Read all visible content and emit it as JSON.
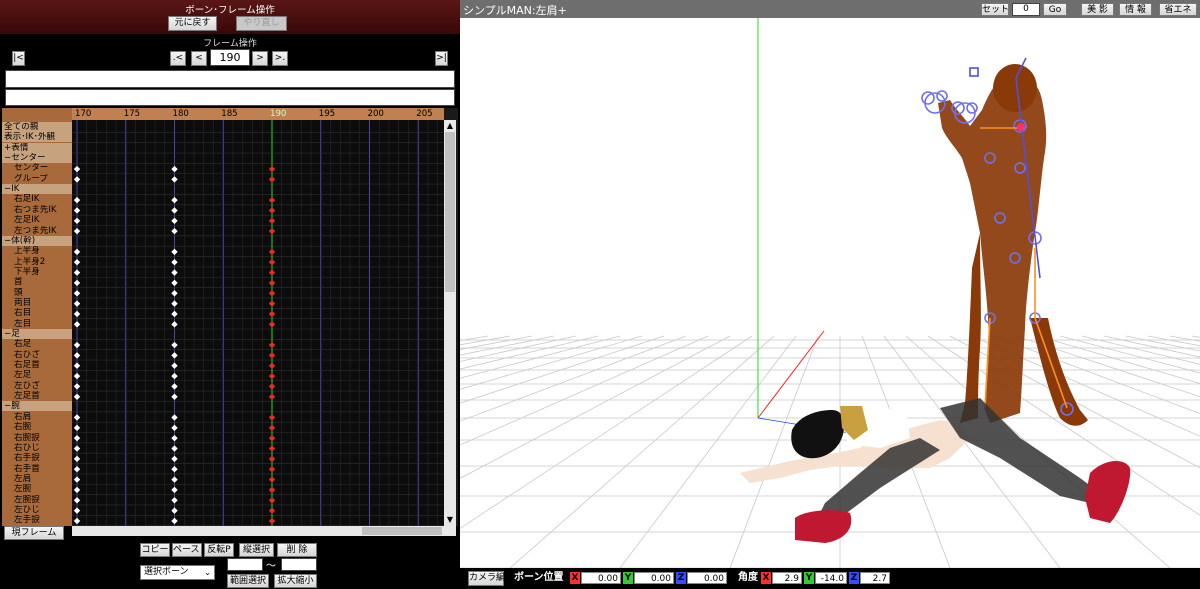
{
  "bone_frame": {
    "title": "ボーン･フレーム操作",
    "undo_label": "元に戻す",
    "redo_label": "やり直し"
  },
  "frame_ops": {
    "title": "フレーム操作",
    "first_label": "|<",
    "prev_key_label": ".<",
    "prev_label": "<",
    "frame_value": "190",
    "next_label": ">",
    "next_key_label": ">.",
    "last_label": ">|"
  },
  "timeline": {
    "ticks": [
      "170",
      "175",
      "180",
      "185",
      "190",
      "195",
      "200",
      "205"
    ],
    "current_frame": "190",
    "rows": [
      {
        "label": "全ての親",
        "type": "group",
        "keys": []
      },
      {
        "label": "表示･IK･外観",
        "type": "group",
        "keys": []
      },
      {
        "label": "+表情",
        "type": "group",
        "keys": []
      },
      {
        "label": "−センター",
        "type": "group",
        "keys": []
      },
      {
        "label": "センター",
        "type": "item",
        "keys": [
          170,
          180,
          190
        ]
      },
      {
        "label": "グループ",
        "type": "item",
        "keys": [
          170,
          180,
          190
        ]
      },
      {
        "label": "−IK",
        "type": "group",
        "keys": []
      },
      {
        "label": "右足IK",
        "type": "item",
        "keys": [
          170,
          180,
          190
        ]
      },
      {
        "label": "右つま先IK",
        "type": "item",
        "keys": [
          170,
          180,
          190
        ]
      },
      {
        "label": "左足IK",
        "type": "item",
        "keys": [
          170,
          180,
          190
        ]
      },
      {
        "label": "左つま先IK",
        "type": "item",
        "keys": [
          170,
          180,
          190
        ]
      },
      {
        "label": "−体(幹)",
        "type": "group",
        "keys": []
      },
      {
        "label": "上半身",
        "type": "item",
        "keys": [
          170,
          180,
          190
        ]
      },
      {
        "label": "上半身2",
        "type": "item",
        "keys": [
          170,
          180,
          190
        ]
      },
      {
        "label": "下半身",
        "type": "item",
        "keys": [
          170,
          180,
          190
        ]
      },
      {
        "label": "首",
        "type": "item",
        "keys": [
          170,
          180,
          190
        ]
      },
      {
        "label": "頭",
        "type": "item",
        "keys": [
          170,
          180,
          190
        ]
      },
      {
        "label": "両目",
        "type": "item",
        "keys": [
          170,
          180,
          190
        ]
      },
      {
        "label": "右目",
        "type": "item",
        "keys": [
          170,
          180,
          190
        ]
      },
      {
        "label": "左目",
        "type": "item",
        "keys": [
          170,
          180,
          190
        ]
      },
      {
        "label": "−足",
        "type": "group",
        "keys": []
      },
      {
        "label": "右足",
        "type": "item",
        "keys": [
          170,
          180,
          190
        ]
      },
      {
        "label": "右ひざ",
        "type": "item",
        "keys": [
          170,
          180,
          190
        ]
      },
      {
        "label": "右足首",
        "type": "item",
        "keys": [
          170,
          180,
          190
        ]
      },
      {
        "label": "左足",
        "type": "item",
        "keys": [
          170,
          180,
          190
        ]
      },
      {
        "label": "左ひざ",
        "type": "item",
        "keys": [
          170,
          180,
          190
        ]
      },
      {
        "label": "左足首",
        "type": "item",
        "keys": [
          170,
          180,
          190
        ]
      },
      {
        "label": "−腕",
        "type": "group",
        "keys": []
      },
      {
        "label": "右肩",
        "type": "item",
        "keys": [
          170,
          180,
          190
        ]
      },
      {
        "label": "右腕",
        "type": "item",
        "keys": [
          170,
          180,
          190
        ]
      },
      {
        "label": "右腕捩",
        "type": "item",
        "keys": [
          170,
          180,
          190
        ]
      },
      {
        "label": "右ひじ",
        "type": "item",
        "keys": [
          170,
          180,
          190
        ]
      },
      {
        "label": "右手捩",
        "type": "item",
        "keys": [
          170,
          180,
          190
        ]
      },
      {
        "label": "右手首",
        "type": "item",
        "keys": [
          170,
          180,
          190
        ]
      },
      {
        "label": "左肩",
        "type": "item",
        "keys": [
          170,
          180,
          190
        ]
      },
      {
        "label": "左腕",
        "type": "item",
        "keys": [
          170,
          180,
          190
        ]
      },
      {
        "label": "左腕捩",
        "type": "item",
        "keys": [
          170,
          180,
          190
        ]
      },
      {
        "label": "左ひじ",
        "type": "item",
        "keys": [
          170,
          180,
          190
        ]
      },
      {
        "label": "左手捩",
        "type": "item",
        "keys": [
          170,
          180,
          190
        ]
      }
    ]
  },
  "bottom": {
    "current_frame_label": "現フレーム",
    "copy_label": "コピー",
    "paste_label": "ペースト",
    "flip_paste_label": "反転P",
    "vertical_select_label": "縦選択",
    "delete_label": "削 除",
    "select_dropdown": "選択ボーン",
    "range_from": "",
    "range_tilde": "〜",
    "range_to": "",
    "range_select_label": "範囲選択",
    "zoom_label": "拡大縮小"
  },
  "viewport": {
    "title": "シンプルMAN:左肩+",
    "set_label": "セット",
    "set_value": "0",
    "go_label": "Go",
    "shadow_label": "美 影",
    "info_label": "情 報",
    "eco_label": "省エネ"
  },
  "status": {
    "camera_edit_label": "カメラ編",
    "bone_pos_label": "ボーン位置",
    "angle_label": "角度",
    "x_label": "X",
    "y_label": "Y",
    "z_label": "Z",
    "pos_x": "0.00",
    "pos_y": "0.00",
    "pos_z": "0.00",
    "rot_x": "2.9",
    "rot_y": "-14.0",
    "rot_z": "2.7"
  },
  "colors": {
    "header_bg": "#4a1010",
    "key_white": "#ffffff",
    "key_red": "#e03020",
    "cursor_green": "#22dd22",
    "label_bg": "#a86a3a",
    "axis_x": "#ff2020",
    "axis_y": "#20d020",
    "axis_z": "#2040ff"
  }
}
